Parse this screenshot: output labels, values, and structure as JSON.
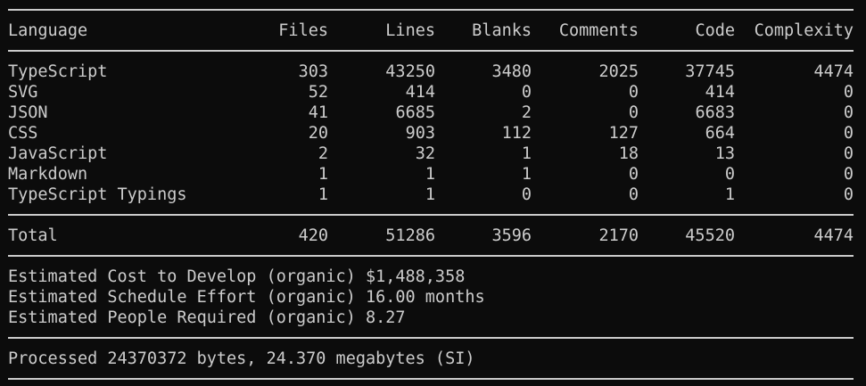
{
  "header": {
    "language": "Language",
    "files": "Files",
    "lines": "Lines",
    "blanks": "Blanks",
    "comments": "Comments",
    "code": "Code",
    "complexity": "Complexity"
  },
  "rows": [
    {
      "language": "TypeScript",
      "files": "303",
      "lines": "43250",
      "blanks": "3480",
      "comments": "2025",
      "code": "37745",
      "complexity": "4474"
    },
    {
      "language": "SVG",
      "files": "52",
      "lines": "414",
      "blanks": "0",
      "comments": "0",
      "code": "414",
      "complexity": "0"
    },
    {
      "language": "JSON",
      "files": "41",
      "lines": "6685",
      "blanks": "2",
      "comments": "0",
      "code": "6683",
      "complexity": "0"
    },
    {
      "language": "CSS",
      "files": "20",
      "lines": "903",
      "blanks": "112",
      "comments": "127",
      "code": "664",
      "complexity": "0"
    },
    {
      "language": "JavaScript",
      "files": "2",
      "lines": "32",
      "blanks": "1",
      "comments": "18",
      "code": "13",
      "complexity": "0"
    },
    {
      "language": "Markdown",
      "files": "1",
      "lines": "1",
      "blanks": "1",
      "comments": "0",
      "code": "0",
      "complexity": "0"
    },
    {
      "language": "TypeScript Typings",
      "files": "1",
      "lines": "1",
      "blanks": "0",
      "comments": "0",
      "code": "1",
      "complexity": "0"
    }
  ],
  "total": {
    "language": "Total",
    "files": "420",
    "lines": "51286",
    "blanks": "3596",
    "comments": "2170",
    "code": "45520",
    "complexity": "4474"
  },
  "estimates": {
    "cost": "Estimated Cost to Develop (organic) $1,488,358",
    "schedule": "Estimated Schedule Effort (organic) 16.00 months",
    "people": "Estimated People Required (organic) 8.27"
  },
  "processed": "Processed 24370372 bytes, 24.370 megabytes (SI)"
}
